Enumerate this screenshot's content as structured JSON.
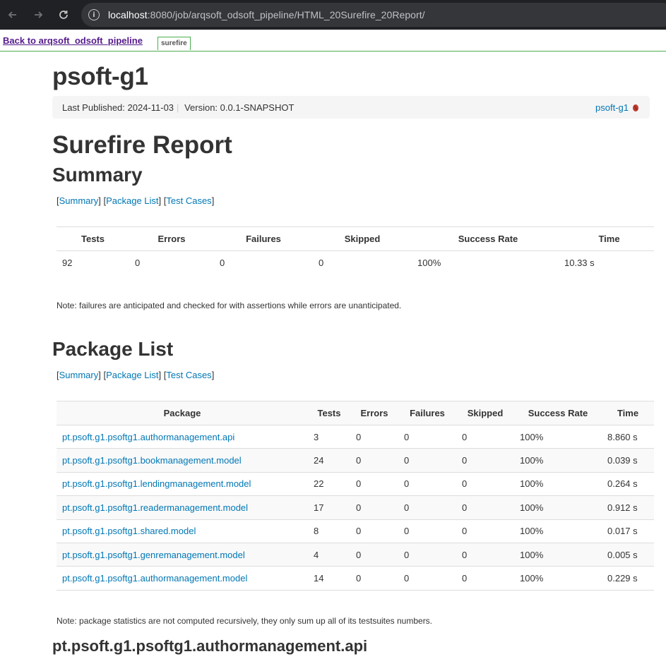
{
  "browser": {
    "url_host": "localhost",
    "url_rest": ":8080/job/arqsoft_odsoft_pipeline/HTML_20Surefire_20Report/"
  },
  "jenkins": {
    "back_link": "Back to arqsoft_odsoft_pipeline",
    "tab_label": "surefire"
  },
  "project": {
    "title": "psoft-g1",
    "last_published": "Last Published: 2024-11-03",
    "version": "Version: 0.0.1-SNAPSHOT",
    "right_link": "psoft-g1"
  },
  "report": {
    "title": "Surefire Report",
    "summary_heading": "Summary",
    "package_list_heading": "Package List",
    "package_heading": "pt.psoft.g1.psoftg1.authormanagement.api"
  },
  "anchors": {
    "summary": "Summary",
    "package_list": "Package List",
    "test_cases": "Test Cases"
  },
  "summary_table": {
    "headers": [
      "Tests",
      "Errors",
      "Failures",
      "Skipped",
      "Success Rate",
      "Time"
    ],
    "row": [
      "92",
      "0",
      "0",
      "0",
      "100%",
      "10.33 s"
    ]
  },
  "notes": {
    "failures_note": "Note: failures are anticipated and checked for with assertions while errors are unanticipated.",
    "package_note": "Note: package statistics are not computed recursively, they only sum up all of its testsuites numbers."
  },
  "package_table": {
    "headers": [
      "Package",
      "Tests",
      "Errors",
      "Failures",
      "Skipped",
      "Success Rate",
      "Time"
    ],
    "rows": [
      [
        "pt.psoft.g1.psoftg1.authormanagement.api",
        "3",
        "0",
        "0",
        "0",
        "100%",
        "8.860 s"
      ],
      [
        "pt.psoft.g1.psoftg1.bookmanagement.model",
        "24",
        "0",
        "0",
        "0",
        "100%",
        "0.039 s"
      ],
      [
        "pt.psoft.g1.psoftg1.lendingmanagement.model",
        "22",
        "0",
        "0",
        "0",
        "100%",
        "0.264 s"
      ],
      [
        "pt.psoft.g1.psoftg1.readermanagement.model",
        "17",
        "0",
        "0",
        "0",
        "100%",
        "0.912 s"
      ],
      [
        "pt.psoft.g1.psoftg1.shared.model",
        "8",
        "0",
        "0",
        "0",
        "100%",
        "0.017 s"
      ],
      [
        "pt.psoft.g1.psoftg1.genremanagement.model",
        "4",
        "0",
        "0",
        "0",
        "100%",
        "0.005 s"
      ],
      [
        "pt.psoft.g1.psoftg1.authormanagement.model",
        "14",
        "0",
        "0",
        "0",
        "100%",
        "0.229 s"
      ]
    ]
  },
  "colors": {
    "link": "#0077b5",
    "heading": "#333333",
    "jenkins_border": "#4caf50",
    "chrome_bg": "#202124"
  },
  "icons": [
    "back-arrow-icon",
    "forward-arrow-icon",
    "reload-icon",
    "info-icon",
    "maven-feather-icon"
  ]
}
